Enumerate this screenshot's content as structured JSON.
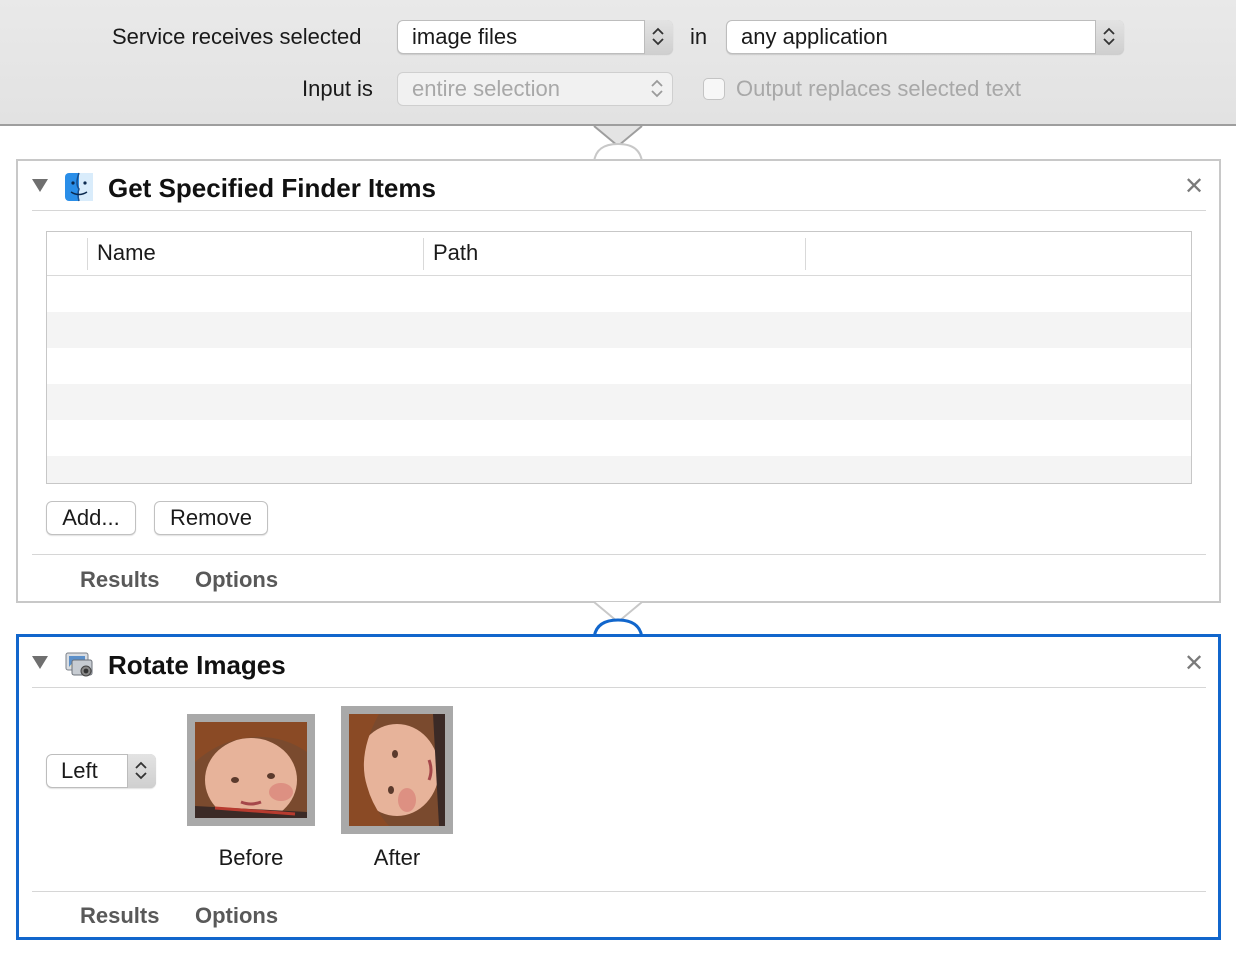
{
  "service": {
    "receives_label": "Service receives selected",
    "type_value": "image files",
    "in_label": "in",
    "app_value": "any application",
    "input_label": "Input is",
    "input_value": "entire selection",
    "output_label": "Output replaces selected text"
  },
  "actions": [
    {
      "title": "Get Specified Finder Items",
      "table": {
        "columns": [
          "Name",
          "Path"
        ],
        "rows": []
      },
      "add_label": "Add...",
      "remove_label": "Remove",
      "tabs": [
        "Results",
        "Options"
      ]
    },
    {
      "title": "Rotate Images",
      "direction": "Left",
      "before_label": "Before",
      "after_label": "After",
      "tabs": [
        "Results",
        "Options"
      ]
    }
  ],
  "colors": {
    "selection": "#1166cc",
    "panel_border": "#c8c8c8",
    "bar_bg": "#e6e6e6"
  }
}
